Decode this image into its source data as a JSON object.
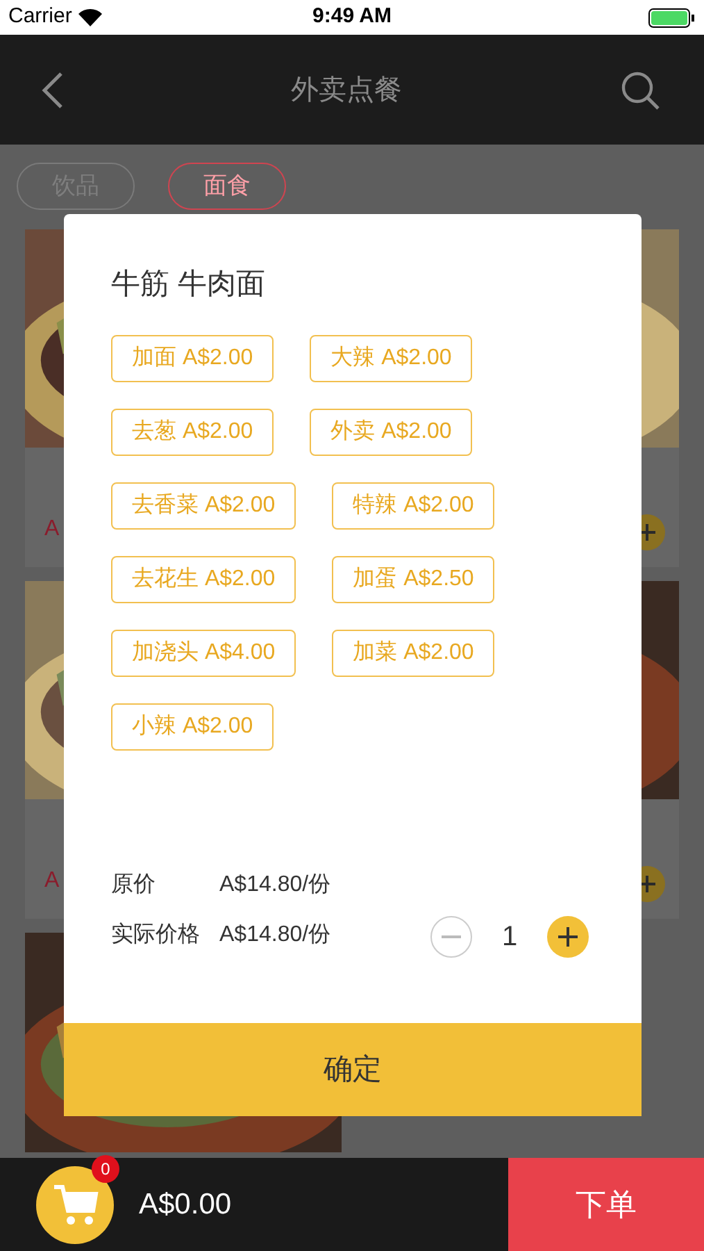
{
  "status_bar": {
    "carrier": "Carrier",
    "time": "9:49 AM"
  },
  "nav": {
    "title": "外卖点餐"
  },
  "categories": [
    {
      "label": "饮品",
      "selected": false
    },
    {
      "label": "面食",
      "selected": true
    }
  ],
  "left_column": [
    {
      "kind": "priced",
      "price": "A"
    },
    {
      "kind": "priced",
      "price": "A"
    },
    {
      "kind": "picture"
    }
  ],
  "right_column": [
    {
      "kind": "addable"
    },
    {
      "kind": "addable"
    }
  ],
  "dialog": {
    "title": "牛筋 牛肉面",
    "options": [
      "加面 A$2.00",
      "大辣 A$2.00",
      "去葱 A$2.00",
      "外卖 A$2.00",
      "去香菜 A$2.00",
      "特辣 A$2.00",
      "去花生 A$2.00",
      "加蛋 A$2.50",
      "加浇头 A$4.00",
      "加菜 A$2.00",
      "小辣 A$2.00"
    ],
    "original_price_label": "原价",
    "original_price": "A$14.80/份",
    "actual_price_label": "实际价格",
    "actual_price": "A$14.80/份",
    "quantity": "1",
    "confirm": "确定"
  },
  "cart": {
    "badge": "0",
    "total": "A$0.00",
    "checkout": "下单"
  }
}
